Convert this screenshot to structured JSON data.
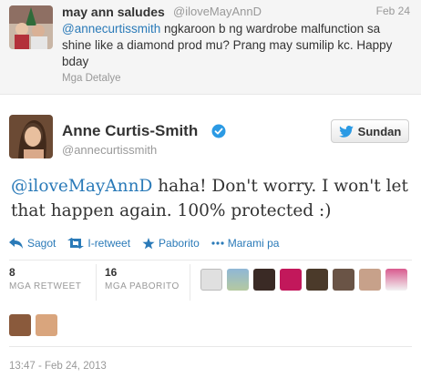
{
  "reply": {
    "name": "may ann saludes",
    "handle": "@iloveMayAnnD",
    "date": "Feb 24",
    "mention": "@annecurtissmith",
    "text": " ngkaroon b ng wardrobe malfunction sa shine like a diamond prod mu? Prang may sumilip kc. Happy bday",
    "details": "Mga Detalye"
  },
  "tweet": {
    "name": "Anne Curtis-Smith",
    "handle": "@annecurtissmith",
    "follow_label": "Sundan",
    "mention": "@iloveMayAnnD",
    "text": " haha! Don't worry. I won't let that happen again. 100% protected :)",
    "timestamp": "13:47 - Feb 24, 2013"
  },
  "actions": {
    "reply": "Sagot",
    "retweet": "I-retweet",
    "favorite": "Paborito",
    "more": "Marami pa"
  },
  "stats": {
    "retweets": {
      "count": "8",
      "label": "MGA RETWEET"
    },
    "favorites": {
      "count": "16",
      "label": "MGA PABORITO"
    }
  },
  "colors": {
    "link": "#2a7ab8",
    "muted": "#999999",
    "verified": "#2b9ae4",
    "twitter_bird": "#2b9ae4"
  },
  "icons": [
    "reply-icon",
    "retweet-icon",
    "star-icon",
    "more-dots-icon",
    "twitter-bird-icon",
    "verified-badge-icon"
  ]
}
